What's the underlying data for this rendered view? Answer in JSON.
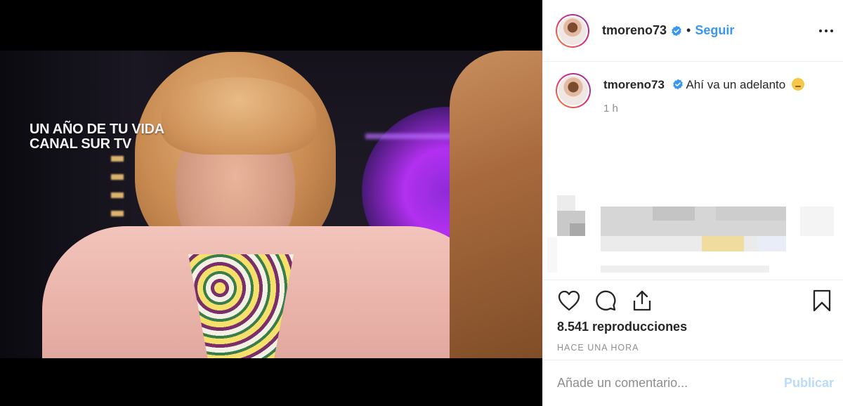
{
  "post": {
    "username": "tmoreno73",
    "follow_label": "Seguir",
    "separator": "•",
    "verified": true
  },
  "media": {
    "caption_line1": "UN AÑO DE TU VIDA",
    "caption_line2": "CANAL SUR TV",
    "channel_logo": "canal-sur-1-logo"
  },
  "caption": {
    "username": "tmoreno73",
    "text": "Ahí va un adelanto",
    "emoji": "zipper-mouth-face-emoji",
    "time": "1 h"
  },
  "stats": {
    "views": "8.541 reproducciones",
    "posted": "HACE UNA HORA"
  },
  "comment_box": {
    "placeholder": "Añade un comentario...",
    "publish_label": "Publicar"
  },
  "colors": {
    "accent": "#3897f0",
    "publish_disabled": "#b9dcfa",
    "secondary_text": "#8e8e8e",
    "border": "#efefef"
  }
}
